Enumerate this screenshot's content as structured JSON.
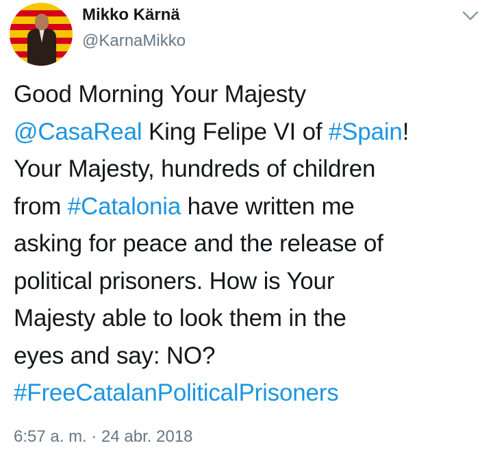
{
  "author": {
    "display_name": "Mikko Kärnä",
    "handle": "@KarnaMikko",
    "avatar_icon": "profile-photo"
  },
  "menu": {
    "icon": "chevron-down-icon"
  },
  "tweet": {
    "lines": [
      [
        {
          "text": "Good Morning Your Majesty",
          "type": "text"
        }
      ],
      [
        {
          "text": "@CasaReal",
          "type": "mention"
        },
        {
          "text": " King Felipe VI of ",
          "type": "text"
        },
        {
          "text": "#Spain",
          "type": "hashtag"
        },
        {
          "text": "!",
          "type": "text"
        }
      ],
      [
        {
          "text": "Your Majesty, hundreds of children",
          "type": "text"
        }
      ],
      [
        {
          "text": "from ",
          "type": "text"
        },
        {
          "text": "#Catalonia",
          "type": "hashtag"
        },
        {
          "text": " have written me",
          "type": "text"
        }
      ],
      [
        {
          "text": "asking for peace and the release of",
          "type": "text"
        }
      ],
      [
        {
          "text": "political prisoners. How is Your",
          "type": "text"
        }
      ],
      [
        {
          "text": "Majesty able to look them in the",
          "type": "text"
        }
      ],
      [
        {
          "text": "eyes and say: NO?",
          "type": "text"
        }
      ],
      [
        {
          "text": "#FreeCatalanPoliticalPrisoners",
          "type": "hashtag"
        }
      ]
    ],
    "timestamp": "6:57 a. m. · 24 abr. 2018"
  },
  "colors": {
    "link": "#1b95e0",
    "text": "#14171a",
    "secondary": "#657786"
  }
}
